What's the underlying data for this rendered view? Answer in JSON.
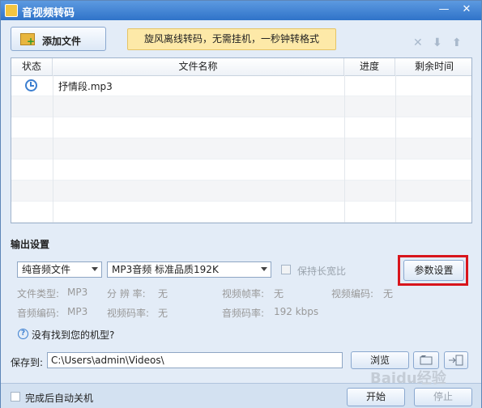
{
  "window": {
    "title": "音视频转码",
    "controls": {
      "min": "—",
      "close": "✕"
    }
  },
  "toolbar": {
    "add_file_label": "添加文件",
    "promo_text": "旋风离线转码，无需挂机，一秒钟转格式",
    "icons": [
      "close-icon",
      "down-arrow-icon",
      "up-arrow-icon"
    ]
  },
  "file_table": {
    "headers": [
      "状态",
      "文件名称",
      "进度",
      "剩余时间"
    ],
    "rows": [
      {
        "status_icon": "clock-icon",
        "name": "抒情段.mp3",
        "progress": "",
        "remaining": ""
      }
    ]
  },
  "output": {
    "section_title": "输出设置",
    "format_select": "纯音频文件",
    "quality_select": "MP3音频 标准品质192K",
    "keep_ratio_label": "保持长宽比",
    "param_button": "参数设置",
    "info": {
      "file_type_label": "文件类型:",
      "file_type_value": "MP3",
      "resolution_label": "分 辨 率:",
      "resolution_value": "无",
      "frame_rate_label": "视频帧率:",
      "frame_rate_value": "无",
      "video_codec_label": "视频编码:",
      "video_codec_value": "无",
      "audio_codec_label": "音频编码:",
      "audio_codec_value": "MP3",
      "video_bitrate_label": "视频码率:",
      "video_bitrate_value": "无",
      "audio_bitrate_label": "音频码率:",
      "audio_bitrate_value": "192 kbps"
    },
    "help_text": "没有找到您的机型?"
  },
  "save": {
    "label": "保存到:",
    "path": "C:\\Users\\admin\\Videos\\",
    "browse_label": "浏览"
  },
  "footer": {
    "shutdown_label": "完成后自动关机",
    "start_label": "开始",
    "stop_label": "停止",
    "watermark": "Baidu经验"
  },
  "colors": {
    "titlebar": "#2f73c9",
    "highlight": "#d8151c",
    "promo": "#fde9a8"
  }
}
